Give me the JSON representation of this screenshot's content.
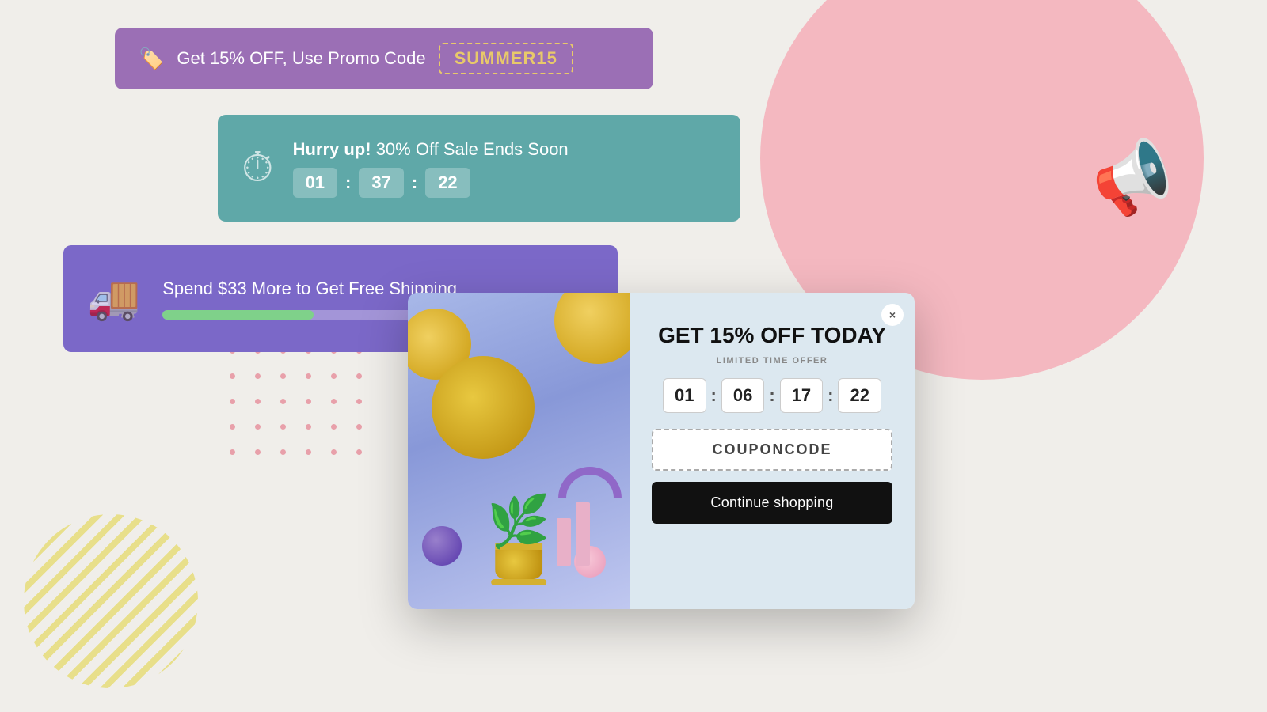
{
  "background": {
    "color": "#f0eeea"
  },
  "promo_banner_1": {
    "text": "Get 15% OFF, Use Promo Code",
    "code": "SUMMER15",
    "tag_icon": "🏷️"
  },
  "promo_banner_2": {
    "prefix": "Hurry up!",
    "text": " 30% Off Sale Ends Soon",
    "clock_icon": "⏱",
    "countdown": {
      "hours": "01",
      "minutes": "37",
      "seconds": "22"
    }
  },
  "promo_banner_3": {
    "text": "Spend $33 More to Get Free Shipping",
    "truck_icon": "🚚",
    "progress_percent": 35
  },
  "popup": {
    "title": "GET 15% OFF TODAY",
    "subtitle": "LIMITED TIME OFFER",
    "close_label": "×",
    "countdown": {
      "hours": "01",
      "minutes": "06",
      "seconds_1": "17",
      "seconds_2": "22"
    },
    "coupon_code": "COUPONCODE",
    "continue_button": "Continue shopping",
    "image_alt": "Decorative product image with plant"
  },
  "decorative": {
    "dot_grid_rows": 5,
    "dot_grid_cols": 6
  }
}
